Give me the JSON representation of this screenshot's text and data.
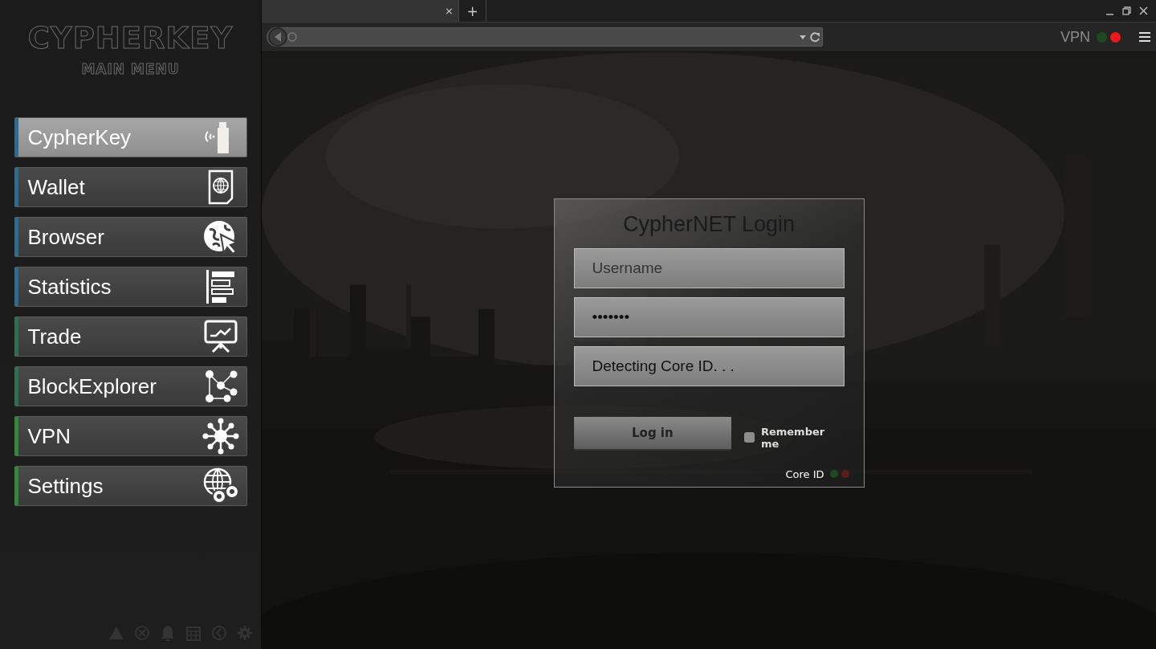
{
  "sidebar": {
    "logo": "CYPHERKEY",
    "subtitle": "MAIN MENU",
    "items": [
      {
        "label": "CypherKey",
        "kind": "usb",
        "selected": true,
        "color": "#2a6d8c"
      },
      {
        "label": "Wallet",
        "kind": "wallet",
        "selected": false,
        "color": "#2a6d8c"
      },
      {
        "label": "Browser",
        "kind": "browser",
        "selected": false,
        "color": "#2a6d8c"
      },
      {
        "label": "Statistics",
        "kind": "stats",
        "selected": false,
        "color": "#2a6d8c"
      },
      {
        "label": "Trade",
        "kind": "trade",
        "selected": false,
        "color": "#2e6e52"
      },
      {
        "label": "BlockExplorer",
        "kind": "network",
        "selected": false,
        "color": "#2e6e52"
      },
      {
        "label": "VPN",
        "kind": "hub",
        "selected": false,
        "color": "#2f8a3a"
      },
      {
        "label": "Settings",
        "kind": "settings",
        "selected": false,
        "color": "#2f8a3a"
      }
    ]
  },
  "browser": {
    "tab": {
      "close": "×"
    },
    "new_tab": "+",
    "vpn": {
      "label": "VPN",
      "dots": [
        {
          "color": "#1f4a1f"
        },
        {
          "color": "#ee1818"
        }
      ]
    }
  },
  "login": {
    "title": "CypherNET Login",
    "username": {
      "placeholder": "Username"
    },
    "password": {
      "value": "•••••••"
    },
    "core_field": {
      "value": "Detecting Core ID. . ."
    },
    "button": "Log in",
    "remember": {
      "label": "Remember me",
      "checked": false
    },
    "core_id": {
      "label": "Core ID",
      "dots": [
        {
          "color": "#1f4a1f"
        },
        {
          "color": "#5a1f14"
        }
      ]
    }
  }
}
